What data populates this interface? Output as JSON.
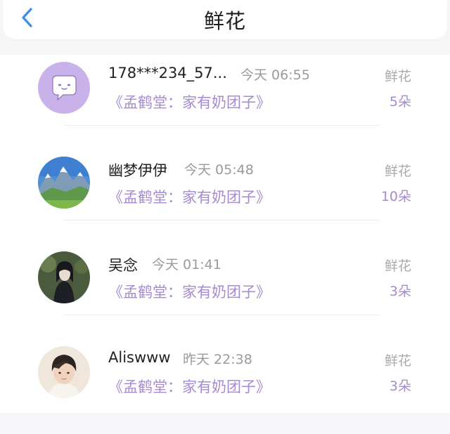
{
  "header": {
    "title": "鲜花",
    "back_icon": "chevron-left-icon",
    "accent": "#3a8ee6"
  },
  "colors": {
    "purple": "#a68bd0",
    "gray": "#9a9a9a"
  },
  "items": [
    {
      "name": "178***234_57...",
      "time": "今天 06:55",
      "book": "《孟鹤堂：家有奶团子》",
      "gift_type": "鲜花",
      "count": "5朵",
      "avatar_icon": "chat-bubble-face-icon"
    },
    {
      "name": "幽梦伊伊",
      "time": "今天 05:48",
      "book": "《孟鹤堂：家有奶团子》",
      "gift_type": "鲜花",
      "count": "10朵",
      "avatar_icon": "mountain-landscape-avatar"
    },
    {
      "name": "吴念",
      "time": "今天 01:41",
      "book": "《孟鹤堂：家有奶团子》",
      "gift_type": "鲜花",
      "count": "3朵",
      "avatar_icon": "anime-character-avatar"
    },
    {
      "name": "Aliswww",
      "time": "昨天 22:38",
      "book": "《孟鹤堂：家有奶团子》",
      "gift_type": "鲜花",
      "count": "3朵",
      "avatar_icon": "boy-portrait-avatar"
    }
  ]
}
